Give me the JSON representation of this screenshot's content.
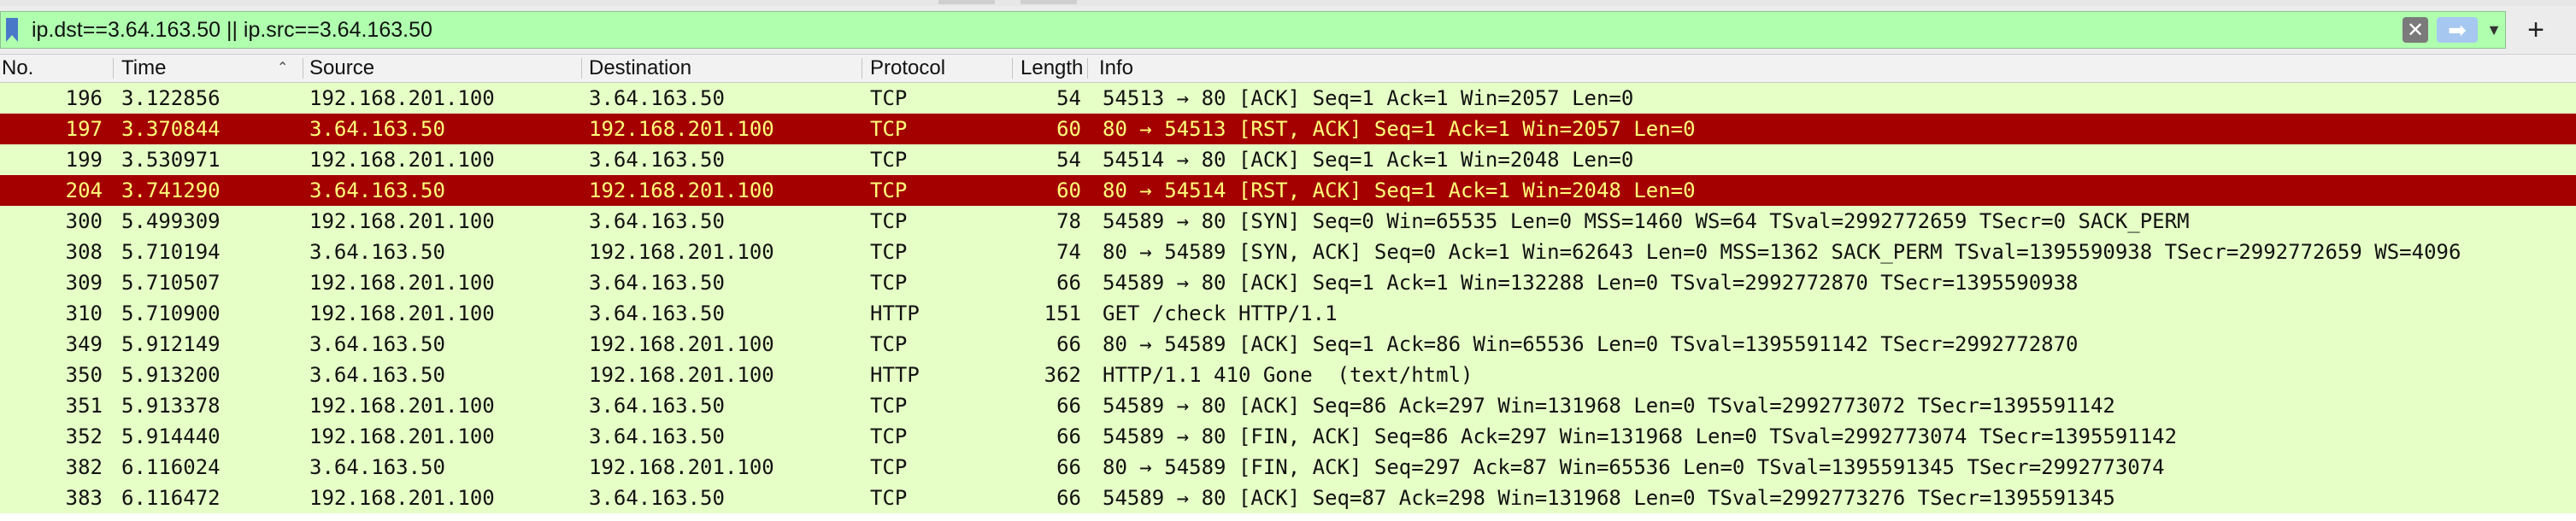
{
  "filter": {
    "value": "ip.dst==3.64.163.50 || ip.src==3.64.163.50",
    "clear_icon": "clear-icon",
    "apply_icon": "arrow-right-icon",
    "dropdown_icon": "chevron-down-icon",
    "add_label": "+"
  },
  "columns": {
    "no": "No.",
    "time": "Time",
    "source": "Source",
    "destination": "Destination",
    "protocol": "Protocol",
    "length": "Length",
    "info": "Info"
  },
  "colors": {
    "tcp_row_bg": "#e5ffc6",
    "rst_row_bg": "#a40000",
    "rst_row_fg": "#ffff7a",
    "filter_bg": "#afffaf"
  },
  "packets": [
    {
      "no": "196",
      "time": "3.122856",
      "source": "192.168.201.100",
      "destination": "3.64.163.50",
      "protocol": "TCP",
      "length": "54",
      "info": "54513 → 80 [ACK] Seq=1 Ack=1 Win=2057 Len=0",
      "rst": false
    },
    {
      "no": "197",
      "time": "3.370844",
      "source": "3.64.163.50",
      "destination": "192.168.201.100",
      "protocol": "TCP",
      "length": "60",
      "info": "80 → 54513 [RST, ACK] Seq=1 Ack=1 Win=2057 Len=0",
      "rst": true
    },
    {
      "no": "199",
      "time": "3.530971",
      "source": "192.168.201.100",
      "destination": "3.64.163.50",
      "protocol": "TCP",
      "length": "54",
      "info": "54514 → 80 [ACK] Seq=1 Ack=1 Win=2048 Len=0",
      "rst": false
    },
    {
      "no": "204",
      "time": "3.741290",
      "source": "3.64.163.50",
      "destination": "192.168.201.100",
      "protocol": "TCP",
      "length": "60",
      "info": "80 → 54514 [RST, ACK] Seq=1 Ack=1 Win=2048 Len=0",
      "rst": true
    },
    {
      "no": "300",
      "time": "5.499309",
      "source": "192.168.201.100",
      "destination": "3.64.163.50",
      "protocol": "TCP",
      "length": "78",
      "info": "54589 → 80 [SYN] Seq=0 Win=65535 Len=0 MSS=1460 WS=64 TSval=2992772659 TSecr=0 SACK_PERM",
      "rst": false
    },
    {
      "no": "308",
      "time": "5.710194",
      "source": "3.64.163.50",
      "destination": "192.168.201.100",
      "protocol": "TCP",
      "length": "74",
      "info": "80 → 54589 [SYN, ACK] Seq=0 Ack=1 Win=62643 Len=0 MSS=1362 SACK_PERM TSval=1395590938 TSecr=2992772659 WS=4096",
      "rst": false
    },
    {
      "no": "309",
      "time": "5.710507",
      "source": "192.168.201.100",
      "destination": "3.64.163.50",
      "protocol": "TCP",
      "length": "66",
      "info": "54589 → 80 [ACK] Seq=1 Ack=1 Win=132288 Len=0 TSval=2992772870 TSecr=1395590938",
      "rst": false
    },
    {
      "no": "310",
      "time": "5.710900",
      "source": "192.168.201.100",
      "destination": "3.64.163.50",
      "protocol": "HTTP",
      "length": "151",
      "info": "GET /check HTTP/1.1",
      "rst": false
    },
    {
      "no": "349",
      "time": "5.912149",
      "source": "3.64.163.50",
      "destination": "192.168.201.100",
      "protocol": "TCP",
      "length": "66",
      "info": "80 → 54589 [ACK] Seq=1 Ack=86 Win=65536 Len=0 TSval=1395591142 TSecr=2992772870",
      "rst": false
    },
    {
      "no": "350",
      "time": "5.913200",
      "source": "3.64.163.50",
      "destination": "192.168.201.100",
      "protocol": "HTTP",
      "length": "362",
      "info": "HTTP/1.1 410 Gone  (text/html)",
      "rst": false
    },
    {
      "no": "351",
      "time": "5.913378",
      "source": "192.168.201.100",
      "destination": "3.64.163.50",
      "protocol": "TCP",
      "length": "66",
      "info": "54589 → 80 [ACK] Seq=86 Ack=297 Win=131968 Len=0 TSval=2992773072 TSecr=1395591142",
      "rst": false
    },
    {
      "no": "352",
      "time": "5.914440",
      "source": "192.168.201.100",
      "destination": "3.64.163.50",
      "protocol": "TCP",
      "length": "66",
      "info": "54589 → 80 [FIN, ACK] Seq=86 Ack=297 Win=131968 Len=0 TSval=2992773074 TSecr=1395591142",
      "rst": false
    },
    {
      "no": "382",
      "time": "6.116024",
      "source": "3.64.163.50",
      "destination": "192.168.201.100",
      "protocol": "TCP",
      "length": "66",
      "info": "80 → 54589 [FIN, ACK] Seq=297 Ack=87 Win=65536 Len=0 TSval=1395591345 TSecr=2992773074",
      "rst": false
    },
    {
      "no": "383",
      "time": "6.116472",
      "source": "192.168.201.100",
      "destination": "3.64.163.50",
      "protocol": "TCP",
      "length": "66",
      "info": "54589 → 80 [ACK] Seq=87 Ack=298 Win=131968 Len=0 TSval=2992773276 TSecr=1395591345",
      "rst": false
    }
  ]
}
